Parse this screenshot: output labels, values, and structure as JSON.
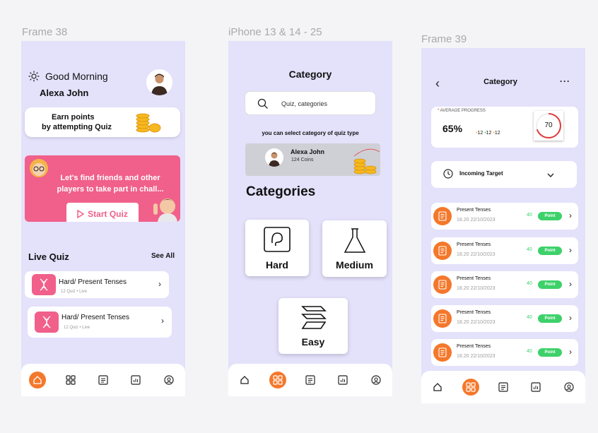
{
  "frame1": {
    "label": "Frame 38",
    "greeting": "Good Morning",
    "user_name": "Alexa John",
    "earn_banner": {
      "line1": "Earn points",
      "line2": "by attempting Quiz"
    },
    "promo": {
      "text": "Let's find friends and other players to take part in chall...",
      "button": "Start Quiz"
    },
    "live_quiz": {
      "title": "Live Quiz",
      "see_all": "See All"
    },
    "quizzes": [
      {
        "title": "Hard/ Present Tenses",
        "count": "12 Quiz",
        "status": "Live"
      },
      {
        "title": "Hard/ Present Tenses",
        "count": "12 Quiz",
        "status": "Live"
      }
    ]
  },
  "frame2": {
    "label": "iPhone 13 & 14 - 25",
    "title": "Category",
    "search_placeholder": "Quiz, categories",
    "subtitle": "you can select category of quiz type",
    "user": {
      "name": "Alexa John",
      "coins": "124 Coins"
    },
    "categories_title": "Categories",
    "categories": [
      "Hard",
      "Medium",
      "Easy"
    ]
  },
  "frame3": {
    "label": "Frame 39",
    "title": "Category",
    "progress": {
      "label": "AVERAGE PROGRESS",
      "percent": "65%",
      "stats": [
        "12",
        "12",
        "12"
      ],
      "ring_value": "70"
    },
    "incoming_target": "Incoming Target",
    "tenses": [
      {
        "title": "Present Tenses",
        "date": "18.20 22/10/2023",
        "points": "40",
        "pill": "Point"
      },
      {
        "title": "Present Tenses",
        "date": "18.20 22/10/2023",
        "points": "40",
        "pill": "Point"
      },
      {
        "title": "Present Tenses",
        "date": "18.20 22/10/2023",
        "points": "40",
        "pill": "Point"
      },
      {
        "title": "Present Tenses",
        "date": "18.20 22/10/2023",
        "points": "40",
        "pill": "Point"
      },
      {
        "title": "Present Tenses",
        "date": "18.20 22/10/2023",
        "points": "40",
        "pill": "Point"
      }
    ]
  },
  "nav_icons": [
    "home-icon",
    "grid-icon",
    "list-icon",
    "chart-icon",
    "profile-icon"
  ],
  "colors": {
    "accent": "#f4782b",
    "frame_bg": "#e4e1fb",
    "promo_pink": "#f0608a",
    "point_green": "#3dd16a"
  }
}
